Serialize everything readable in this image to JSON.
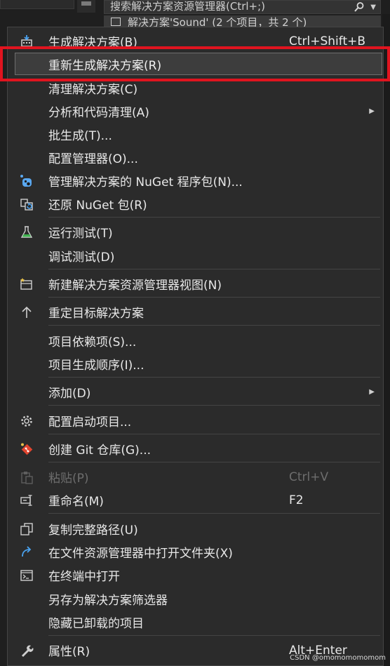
{
  "background": {
    "search_placeholder": "搜索解决方案资源管理器(Ctrl+;)",
    "solution_row": "解决方案'Sound' (2 个项目，共 2 个)"
  },
  "menu": {
    "items": [
      {
        "label": "生成解决方案(B)",
        "shortcut": "Ctrl+Shift+B",
        "icon": "build-icon"
      },
      {
        "label": "重新生成解决方案(R)",
        "shortcut": "",
        "icon": "",
        "highlighted": true
      },
      {
        "label": "清理解决方案(C)",
        "shortcut": "",
        "icon": ""
      },
      {
        "label": "分析和代码清理(A)",
        "shortcut": "",
        "icon": "",
        "submenu": true
      },
      {
        "label": "批生成(T)...",
        "shortcut": "",
        "icon": ""
      },
      {
        "label": "配置管理器(O)...",
        "shortcut": "",
        "icon": ""
      },
      {
        "label": "管理解决方案的 NuGet 程序包(N)...",
        "shortcut": "",
        "icon": "nuget-icon"
      },
      {
        "label": "还原 NuGet 包(R)",
        "shortcut": "",
        "icon": "restore-icon"
      },
      {
        "label": "运行测试(T)",
        "shortcut": "",
        "icon": "flask-icon"
      },
      {
        "label": "调试测试(D)",
        "shortcut": "",
        "icon": ""
      },
      {
        "label": "新建解决方案资源管理器视图(N)",
        "shortcut": "",
        "icon": "new-view-icon"
      },
      {
        "label": "重定目标解决方案",
        "shortcut": "",
        "icon": "arrow-up-icon"
      },
      {
        "label": "项目依赖项(S)...",
        "shortcut": "",
        "icon": ""
      },
      {
        "label": "项目生成顺序(I)...",
        "shortcut": "",
        "icon": ""
      },
      {
        "label": "添加(D)",
        "shortcut": "",
        "icon": "",
        "submenu": true
      },
      {
        "label": "配置启动项目...",
        "shortcut": "",
        "icon": "gear-icon"
      },
      {
        "label": "创建 Git 仓库(G)...",
        "shortcut": "",
        "icon": "git-icon"
      },
      {
        "label": "粘贴(P)",
        "shortcut": "Ctrl+V",
        "icon": "paste-icon",
        "disabled": true
      },
      {
        "label": "重命名(M)",
        "shortcut": "F2",
        "icon": "rename-icon"
      },
      {
        "label": "复制完整路径(U)",
        "shortcut": "",
        "icon": "copy-icon"
      },
      {
        "label": "在文件资源管理器中打开文件夹(X)",
        "shortcut": "",
        "icon": "open-folder-icon"
      },
      {
        "label": "在终端中打开",
        "shortcut": "",
        "icon": "terminal-icon"
      },
      {
        "label": "另存为解决方案筛选器",
        "shortcut": "",
        "icon": ""
      },
      {
        "label": "隐藏已卸载的项目",
        "shortcut": "",
        "icon": ""
      },
      {
        "label": "属性(R)",
        "shortcut": "Alt+Enter",
        "icon": "wrench-icon"
      }
    ]
  },
  "watermark": "CSDN @omomomomomom"
}
